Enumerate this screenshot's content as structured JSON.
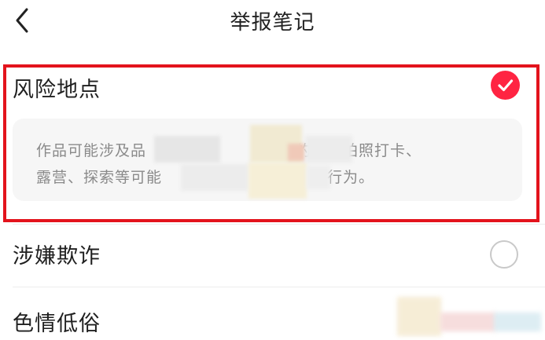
{
  "header": {
    "title": "举报笔记"
  },
  "options": [
    {
      "label": "风险地点",
      "selected": true,
      "description_line1": "作品可能涉及品",
      "description_line1_tail": "的景点拍照打卡、",
      "description_line2": "露营、探索等可能",
      "description_line2_tail": "的行为。"
    },
    {
      "label": "涉嫌欺诈",
      "selected": false
    },
    {
      "label": "色情低俗",
      "selected": false
    }
  ],
  "icons": {
    "back": "chevron-left-icon",
    "selected": "check-circle-icon",
    "unselected": "empty-circle-icon"
  },
  "colors": {
    "accent": "#ff2442",
    "highlight_frame": "#e3131c"
  }
}
